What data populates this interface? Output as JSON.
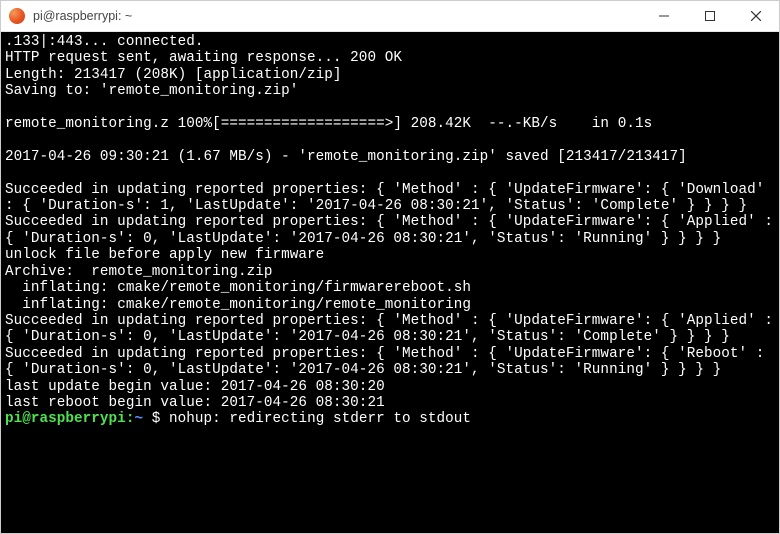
{
  "window": {
    "title": "pi@raspberrypi: ~"
  },
  "terminal": {
    "lines": [
      ".133|:443... connected.",
      "HTTP request sent, awaiting response... 200 OK",
      "Length: 213417 (208K) [application/zip]",
      "Saving to: 'remote_monitoring.zip'",
      "",
      "remote_monitoring.z 100%[===================>] 208.42K  --.-KB/s    in 0.1s",
      "",
      "2017-04-26 09:30:21 (1.67 MB/s) - 'remote_monitoring.zip' saved [213417/213417]",
      "",
      "Succeeded in updating reported properties: { 'Method' : { 'UpdateFirmware': { 'Download' : { 'Duration-s': 1, 'LastUpdate': '2017-04-26 08:30:21', 'Status': 'Complete' } } } }",
      "Succeeded in updating reported properties: { 'Method' : { 'UpdateFirmware': { 'Applied' : { 'Duration-s': 0, 'LastUpdate': '2017-04-26 08:30:21', 'Status': 'Running' } } } }",
      "unlock file before apply new firmware",
      "Archive:  remote_monitoring.zip",
      "  inflating: cmake/remote_monitoring/firmwarereboot.sh",
      "  inflating: cmake/remote_monitoring/remote_monitoring",
      "Succeeded in updating reported properties: { 'Method' : { 'UpdateFirmware': { 'Applied' : { 'Duration-s': 0, 'LastUpdate': '2017-04-26 08:30:21', 'Status': 'Complete' } } } }",
      "Succeeded in updating reported properties: { 'Method' : { 'UpdateFirmware': { 'Reboot' : { 'Duration-s': 0, 'LastUpdate': '2017-04-26 08:30:21', 'Status': 'Running' } } } }",
      "last update begin value: 2017-04-26 08:30:20",
      "last reboot begin value: 2017-04-26 08:30:21"
    ],
    "prompt": {
      "user_host": "pi@raspberrypi",
      "colon": ":",
      "path": "~",
      "dollar": " $ ",
      "tail": "nohup: redirecting stderr to stdout"
    }
  }
}
